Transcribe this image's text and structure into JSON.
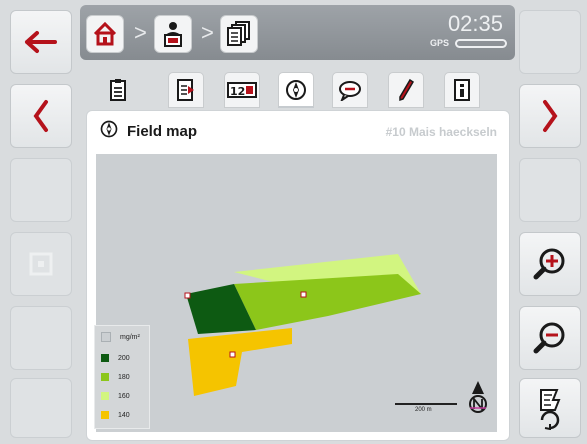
{
  "header": {
    "time": "02:35",
    "gps_label": "GPS"
  },
  "panel": {
    "title": "Field map",
    "subtitle": "#10 Mais haeckseln"
  },
  "legend": {
    "unit": "mg/m²",
    "entries": [
      {
        "label": "200",
        "color": "#0d5a12"
      },
      {
        "label": "180",
        "color": "#8cc61a"
      },
      {
        "label": "160",
        "color": "#d2f580"
      },
      {
        "label": "140",
        "color": "#f5c400"
      }
    ]
  },
  "scale": {
    "label": "200 m"
  },
  "icons": {
    "back": "arrow-left-icon",
    "prev": "chevron-left-icon",
    "next": "chevron-right-icon",
    "zoom_in": "zoom-in-icon",
    "zoom_out": "zoom-out-icon",
    "rotate": "rotate-map-icon",
    "north": "north-arrow-icon"
  },
  "colors": {
    "accent": "#b5121b",
    "header": "#8f9499",
    "field_dark": "#0d5a12",
    "field_mid": "#8cc61a",
    "field_light": "#d2f580",
    "field_yellow": "#f5c400"
  }
}
